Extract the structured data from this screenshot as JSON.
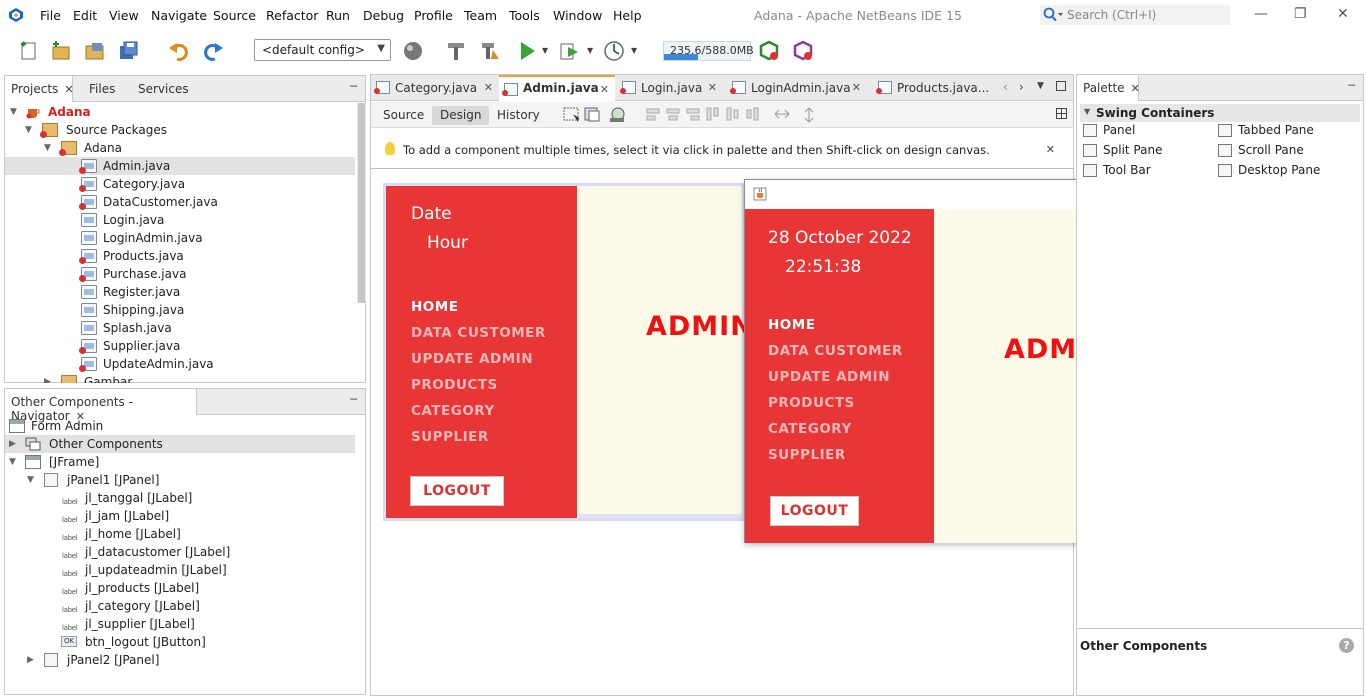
{
  "menu": [
    "File",
    "Edit",
    "View",
    "Navigate",
    "Source",
    "Refactor",
    "Run",
    "Debug",
    "Profile",
    "Team",
    "Tools",
    "Window",
    "Help"
  ],
  "window_title": "Adana - Apache NetBeans IDE 15",
  "search": {
    "placeholder": "Search (Ctrl+I)"
  },
  "toolbar": {
    "config": "<default config>",
    "memory": "235.6/588.0MB",
    "memory_fraction": 0.4
  },
  "projects_panel": {
    "tabs": [
      "Projects",
      "Files",
      "Services"
    ],
    "tree": {
      "project": "Adana",
      "source_packages": "Source Packages",
      "package": "Adana",
      "files": [
        "Admin.java",
        "Category.java",
        "DataCustomer.java",
        "Login.java",
        "LoginAdmin.java",
        "Products.java",
        "Purchase.java",
        "Register.java",
        "Shipping.java",
        "Splash.java",
        "Supplier.java",
        "UpdateAdmin.java"
      ],
      "next_package": "Gambar"
    }
  },
  "navigator_panel": {
    "title": "Other Components - Navigator",
    "form": "Form Admin",
    "other_components": "Other Components",
    "jframe": "[JFrame]",
    "jpanel1": "jPanel1 [JPanel]",
    "children": [
      "jl_tanggal [JLabel]",
      "jl_jam [JLabel]",
      "jl_home [JLabel]",
      "jl_datacustomer [JLabel]",
      "jl_updateadmin [JLabel]",
      "jl_products [JLabel]",
      "jl_category [JLabel]",
      "jl_supplier [JLabel]",
      "btn_logout [JButton]"
    ],
    "jpanel2": "jPanel2 [JPanel]",
    "label_icon": "label",
    "button_icon": "OK"
  },
  "editor": {
    "tabs": [
      "Category.java",
      "Admin.java",
      "Login.java",
      "LoginAdmin.java",
      "Products.java..."
    ],
    "active_tab": "Admin.java",
    "views": [
      "Source",
      "Design",
      "History"
    ],
    "active_view": "Design",
    "hint": "To add a component multiple times, select it via click in palette and then Shift-click on design canvas."
  },
  "design_form": {
    "date": "Date",
    "hour": "Hour",
    "nav": [
      "HOME",
      "DATA CUSTOMER",
      "UPDATE ADMIN",
      "PRODUCTS",
      "CATEGORY",
      "SUPPLIER"
    ],
    "logout": "LOGOUT",
    "title_partial": "ADMINI"
  },
  "running_window": {
    "date": "28 October 2022",
    "time": "22:51:38",
    "nav": [
      "HOME",
      "DATA CUSTOMER",
      "UPDATE ADMIN",
      "PRODUCTS",
      "CATEGORY",
      "SUPPLIER"
    ],
    "logout": "LOGOUT",
    "title": "ADMINISTRATOR"
  },
  "palette": {
    "tab": "Palette",
    "section": "Swing Containers",
    "items": [
      "Panel",
      "Tabbed Pane",
      "Split Pane",
      "Scroll Pane",
      "Tool Bar",
      "Desktop Pane"
    ],
    "bottom": "Other Components"
  },
  "colors": {
    "red_panel": "#e83535",
    "cream": "#fdfaea",
    "title_red": "#ee1111",
    "accent_tab": "#f0a030"
  }
}
